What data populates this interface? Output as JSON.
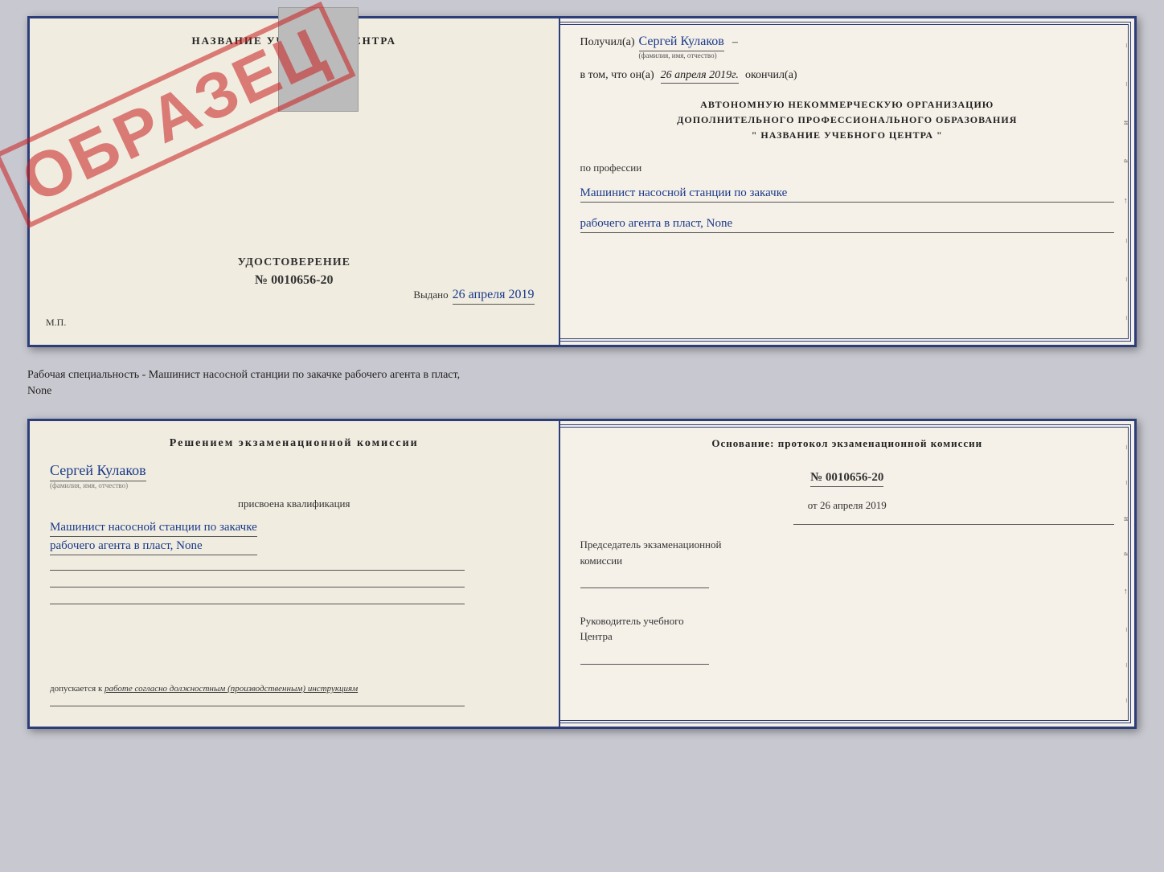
{
  "top_doc": {
    "left": {
      "title": "НАЗВАНИЕ УЧЕБНОГО ЦЕНТРА",
      "obrazec": "ОБРАЗЕЦ",
      "udostoverenie_label": "УДОСТОВЕРЕНИЕ",
      "number": "№ 0010656-20",
      "vydano_label": "Выдано",
      "vydano_date": "26 апреля 2019",
      "mp": "М.П."
    },
    "right": {
      "poluchil_label": "Получил(а)",
      "recipient_name": "Сергей Кулаков",
      "recipient_sub": "(фамилия, имя, отчество)",
      "vtom_label": "в том, что он(а)",
      "date": "26 апреля 2019г.",
      "okonchil_label": "окончил(а)",
      "org_line1": "АВТОНОМНУЮ НЕКОММЕРЧЕСКУЮ ОРГАНИЗАЦИЮ",
      "org_line2": "ДОПОЛНИТЕЛЬНОГО ПРОФЕССИОНАЛЬНОГО ОБРАЗОВАНИЯ",
      "org_line3": "\"  НАЗВАНИЕ УЧЕБНОГО ЦЕНТРА  \"",
      "po_professii": "по профессии",
      "profession_line1": "Машинист насосной станции по закачке",
      "profession_line2": "рабочего агента в пласт, None"
    }
  },
  "between": {
    "text_line1": "Рабочая специальность - Машинист насосной станции по закачке рабочего агента в пласт,",
    "text_line2": "None"
  },
  "bottom_doc": {
    "left": {
      "resheniem": "Решением  экзаменационной  комиссии",
      "person_name": "Сергей Кулаков",
      "person_sub": "(фамилия, имя, отчество)",
      "prisvoyena": "присвоена квалификация",
      "qualification_line1": "Машинист насосной станции по закачке",
      "qualification_line2": "рабочего агента в пласт, None",
      "dopuskaetsya": "допускается к",
      "dopusk_text": "работе согласно должностным (производственным) инструкциям"
    },
    "right": {
      "osnovaniye": "Основание:  протокол  экзаменационной  комиссии",
      "protocol_number": "№  0010656-20",
      "ot_label": "от",
      "ot_date": "26 апреля 2019",
      "predsedatel_label": "Председатель экзаменационной",
      "komissia_label": "комиссии",
      "rukovoditel_label": "Руководитель учебного",
      "tsentra_label": "Центра"
    }
  }
}
